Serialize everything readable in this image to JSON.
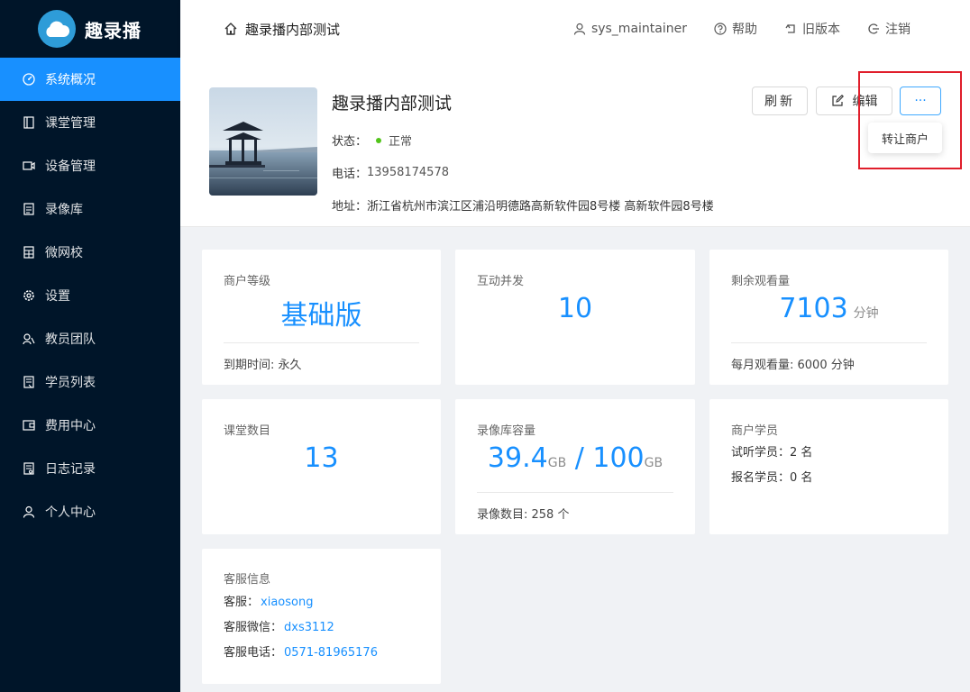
{
  "brand": {
    "name": "趣录播",
    "accent": "#1890ff"
  },
  "sidebar": {
    "items": [
      {
        "label": "系统概况",
        "icon": "dashboard-icon",
        "active": true
      },
      {
        "label": "课堂管理",
        "icon": "book-icon"
      },
      {
        "label": "设备管理",
        "icon": "camera-icon"
      },
      {
        "label": "录像库",
        "icon": "file-list-icon"
      },
      {
        "label": "微网校",
        "icon": "calculator-icon"
      },
      {
        "label": "设置",
        "icon": "gear-icon"
      },
      {
        "label": "教员团队",
        "icon": "team-icon"
      },
      {
        "label": "学员列表",
        "icon": "profile-icon"
      },
      {
        "label": "费用中心",
        "icon": "wallet-icon"
      },
      {
        "label": "日志记录",
        "icon": "log-icon"
      },
      {
        "label": "个人中心",
        "icon": "user-icon"
      }
    ]
  },
  "header": {
    "title": "趣录播内部测试",
    "user": "sys_maintainer",
    "help": "帮助",
    "old_version": "旧版本",
    "logout": "注销"
  },
  "merchant": {
    "name": "趣录播内部测试",
    "status_label": "状态：",
    "status_value": "正常",
    "phone_label": "电话：",
    "phone": "13958174578",
    "address_label": "地址：",
    "address": "浙江省杭州市滨江区浦沿明德路高新软件园8号楼 高新软件园8号楼",
    "refresh_label": "刷新",
    "edit_label": "编辑",
    "more_label": "···",
    "dropdown_item": "转让商户"
  },
  "cards": {
    "level": {
      "label": "商户等级",
      "value": "基础版",
      "foot": "到期时间: 永久"
    },
    "concurrency": {
      "label": "互动并发",
      "value": "10"
    },
    "viewing": {
      "label": "剩余观看量",
      "value": "7103",
      "unit": "分钟",
      "foot": "每月观看量: 6000 分钟"
    },
    "classrooms": {
      "label": "课堂数目",
      "value": "13"
    },
    "storage": {
      "label": "录像库容量",
      "used": "39.4",
      "used_unit": "GB",
      "sep": " / ",
      "total": "100",
      "total_unit": "GB",
      "foot": "录像数目: 258 个"
    },
    "students": {
      "label": "商户学员",
      "trial": "试听学员：2 名",
      "enrolled": "报名学员：0 名"
    },
    "service": {
      "label": "客服信息",
      "name_label": "客服：",
      "name": "xiaosong",
      "wechat_label": "客服微信：",
      "wechat": "dxs3112",
      "phone_label": "客服电话：",
      "phone": "0571-81965176"
    }
  }
}
